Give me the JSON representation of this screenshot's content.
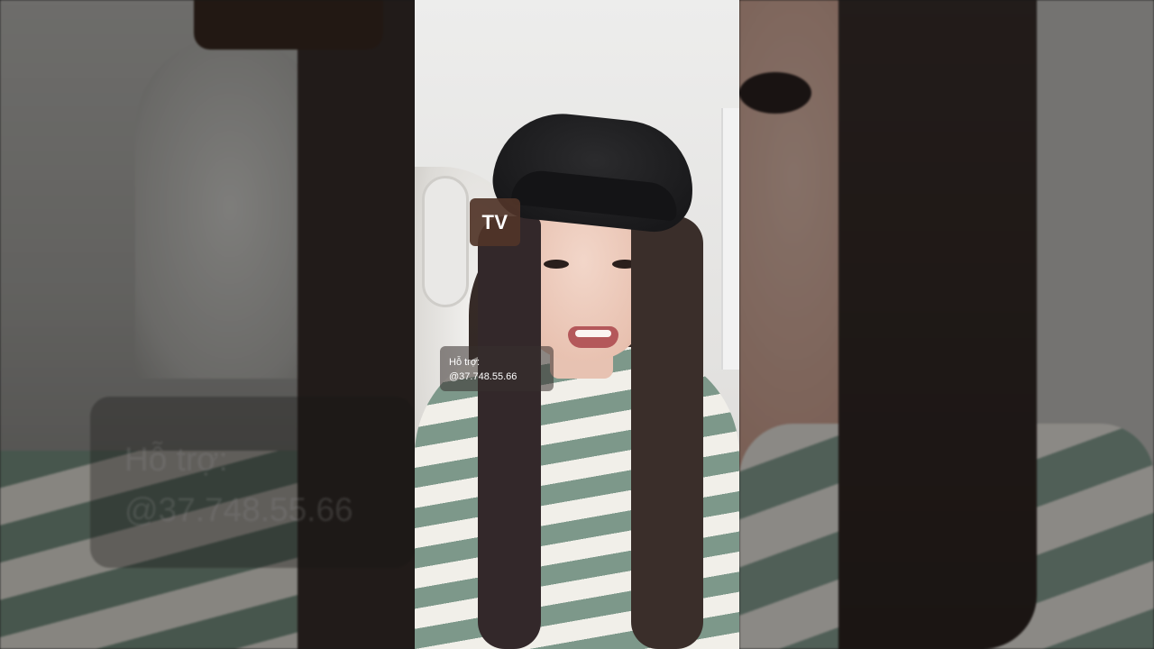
{
  "overlay": {
    "badge_text": "TV",
    "support_label": "Hỗ trợ:",
    "support_handle": "@37.748.55.66"
  },
  "colors": {
    "badge_bg": "#503428",
    "caption_bg": "#37302e",
    "sweater_green": "#7d988a",
    "sweater_cream": "#f1efe9"
  }
}
